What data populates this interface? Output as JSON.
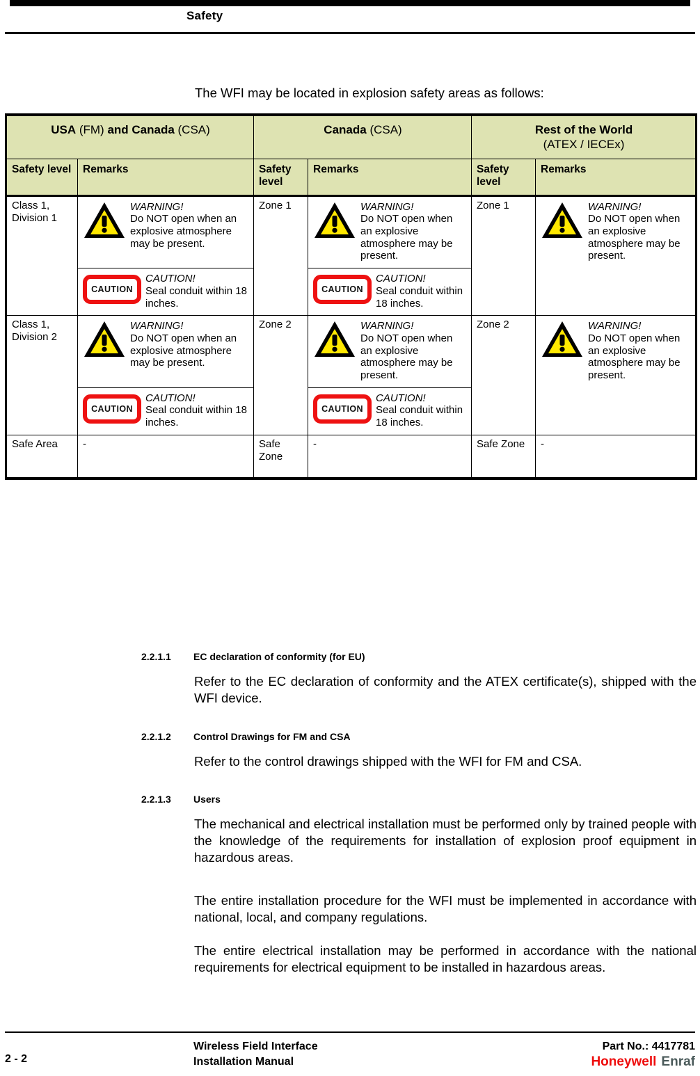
{
  "page": {
    "header_title": "Safety",
    "intro": "The WFI may be located in explosion safety areas as follows:"
  },
  "table": {
    "header_bg": "#dee3b2",
    "groups": [
      {
        "bold": "USA",
        "reg": " (FM) ",
        "bold2": "and Canada",
        "reg2": " (CSA)"
      },
      {
        "bold": "Canada",
        "reg": " (CSA)"
      },
      {
        "bold": "Rest of the World",
        "reg": "(ATEX / IECEx)"
      }
    ],
    "subheaders": {
      "safety_level": "Safety level",
      "remarks": "Remarks"
    },
    "rows": [
      {
        "usa_level": "Class 1, Division 1",
        "canada_level": "Zone 1",
        "row_level": "Zone 1",
        "warning": {
          "lead": "WARNING!",
          "text": "Do NOT open when an explosive atmosphere may be present."
        },
        "caution": {
          "lead": "CAUTION!",
          "text": "Seal conduit within 18 inches."
        },
        "caution_icon_label": "CAUTION"
      },
      {
        "usa_level": "Class 1, Division 2",
        "canada_level": "Zone 2",
        "row_level": "Zone 2",
        "warning": {
          "lead": "WARNING!",
          "text": "Do NOT open when an explosive atmosphere may be present."
        },
        "caution": {
          "lead": "CAUTION!",
          "text": "Seal conduit within 18 inches."
        },
        "caution_icon_label": "CAUTION"
      }
    ],
    "safe_row": {
      "usa_level": "Safe Area",
      "usa_remarks": "-",
      "canada_level": "Safe Zone",
      "canada_remarks": "-",
      "world_level": "Safe Zone",
      "world_remarks": "-"
    }
  },
  "sections": [
    {
      "number": "2.2.1.1",
      "title": "EC declaration of conformity (for EU)",
      "body": "Refer to the EC declaration of conformity and the ATEX certificate(s), shipped with the WFI device."
    },
    {
      "number": "2.2.1.2",
      "title": "Control Drawings for FM and CSA",
      "body": "Refer to the control drawings shipped with the WFI for FM and CSA."
    },
    {
      "number": "2.2.1.3",
      "title": "Users",
      "body": "The mechanical and electrical installation must be performed only by trained people with the knowledge of the requirements for installation of explosion proof equipment in hazardous areas.",
      "body2": "The entire installation procedure for the WFI must be implemented in accordance with national, local, and company regulations.",
      "body3": "The entire electrical installation may be performed in accordance with the national requirements for electrical equipment to be installed in hazardous areas."
    }
  ],
  "footer": {
    "page_number": "2 - 2",
    "doc_line1": "Wireless Field Interface",
    "doc_line2": "Installation Manual",
    "part_no": "Part No.: 4417781",
    "logo_primary": "Honeywell",
    "logo_secondary": "Enraf",
    "logo_primary_color": "#ee0d0d",
    "logo_secondary_color": "#4a5a5a"
  }
}
